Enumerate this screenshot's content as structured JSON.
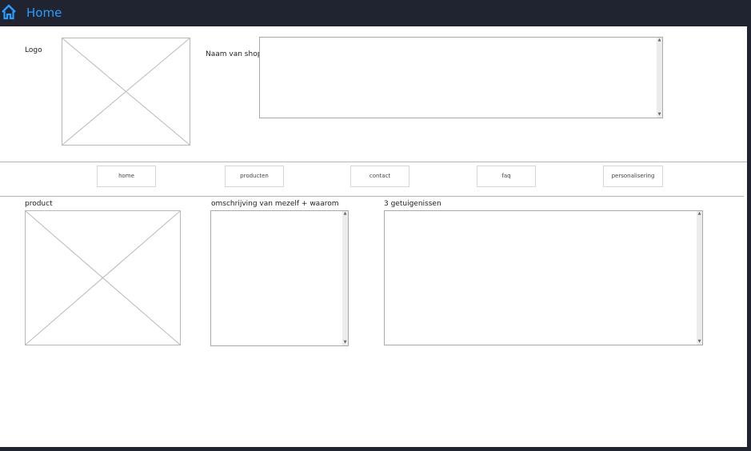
{
  "topbar": {
    "title": "Home",
    "icon": "home-icon",
    "accent_color": "#2b9cff",
    "background_color": "#1f2430"
  },
  "header": {
    "logo_label": "Logo",
    "shop_name_label": "Naam van shop"
  },
  "nav": {
    "items": [
      {
        "label": "home"
      },
      {
        "label": "producten"
      },
      {
        "label": "contact"
      },
      {
        "label": "faq"
      },
      {
        "label": "personalisering"
      }
    ]
  },
  "content": {
    "product_label": "product",
    "description_label": "omschrijving van mezelf + waarom",
    "testimonials_label": "3 getuigenissen"
  }
}
